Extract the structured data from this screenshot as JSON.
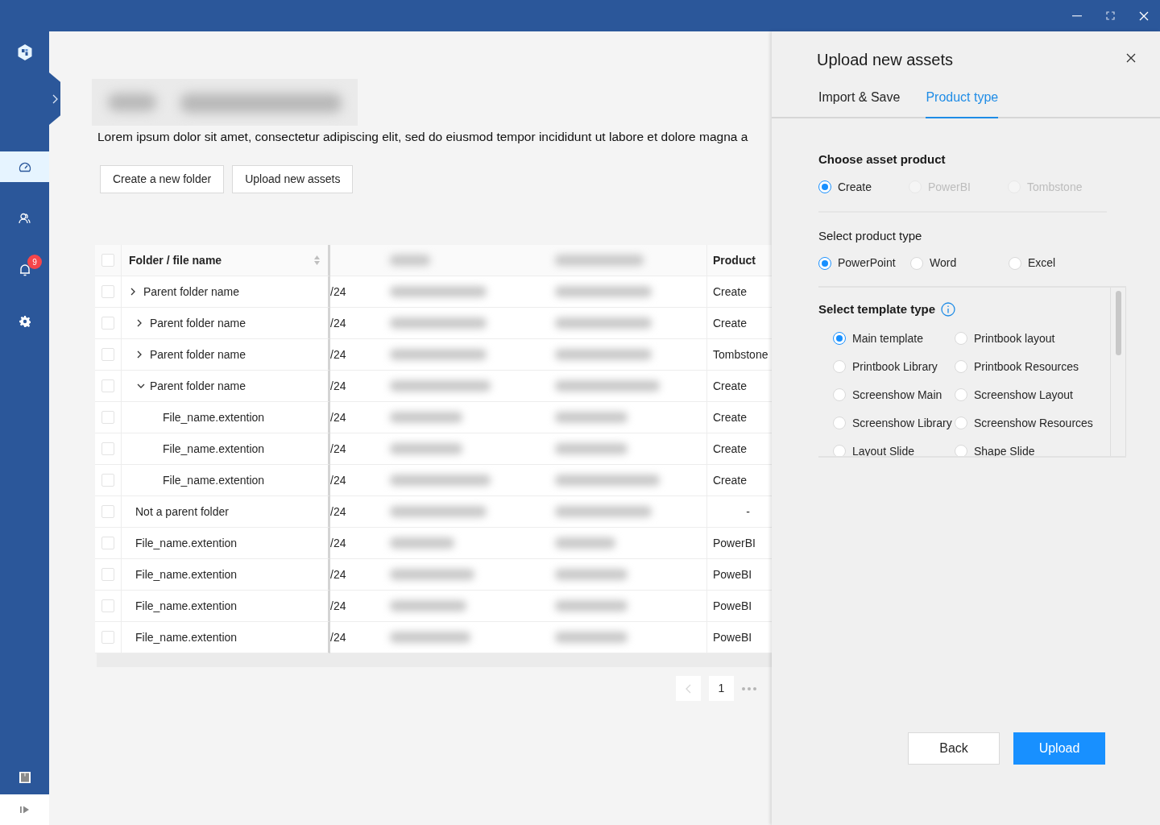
{
  "sidebar": {
    "items": [
      {
        "kind": "dashboard",
        "selected": true
      },
      {
        "kind": "users",
        "selected": false
      },
      {
        "kind": "bell",
        "selected": false,
        "badge": "9"
      },
      {
        "kind": "settings",
        "selected": false
      }
    ]
  },
  "page": {
    "description": "Lorem ipsum dolor sit amet, consectetur adipiscing elit, sed do eiusmod tempor incididunt ut labore et dolore magna a",
    "actions": [
      "Create a new folder",
      "Upload new assets"
    ]
  },
  "table": {
    "header": {
      "name": "Folder / file name",
      "product": "Product",
      "checked": false
    },
    "rows": [
      {
        "kind": "folder",
        "checked": false,
        "name": "Parent folder name",
        "expanded": false,
        "column_2": "/24",
        "product": "Create"
      },
      {
        "kind": "folder",
        "checked": false,
        "name": "Parent folder name",
        "expanded": false,
        "column_2": "/24",
        "product": "Create"
      },
      {
        "kind": "folder",
        "checked": false,
        "name": "Parent folder name",
        "expanded": false,
        "column_2": "/24",
        "product": "Tombstone"
      },
      {
        "kind": "folder",
        "checked": false,
        "name": "Parent folder name",
        "expanded": true,
        "column_2": "/24",
        "product": "Create",
        "children": [
          {
            "kind": "file",
            "checked": false,
            "name": "File_name.extention",
            "column_2": "/24",
            "product": "Create"
          },
          {
            "kind": "file",
            "checked": false,
            "name": "File_name.extention",
            "column_2": "/24",
            "product": "Create"
          },
          {
            "kind": "file",
            "checked": false,
            "name": "File_name.extention",
            "column_2": "/24",
            "product": "Create"
          }
        ]
      },
      {
        "kind": "file",
        "checked": false,
        "name": "Not a parent folder",
        "column_2": "/24",
        "product": "-"
      },
      {
        "kind": "file",
        "checked": false,
        "name": "File_name.extention",
        "column_2": "/24",
        "product": "PowerBI"
      },
      {
        "kind": "file",
        "checked": false,
        "name": "File_name.extention",
        "column_2": "/24",
        "product": "PoweBI"
      },
      {
        "kind": "file",
        "checked": false,
        "name": "File_name.extention",
        "column_2": "/24",
        "product": "PoweBI"
      },
      {
        "kind": "file",
        "checked": false,
        "name": "File_name.extention",
        "column_2": "/24",
        "product": "PoweBI"
      }
    ]
  },
  "pagination": {
    "page": "1"
  },
  "panel": {
    "title": "Upload new assets",
    "tabs": [
      {
        "label": "Import & Save",
        "selected": false
      },
      {
        "label": "Product type",
        "selected": true
      }
    ],
    "sections": [
      {
        "kind": "inline",
        "title": "Choose asset product",
        "bold": true,
        "info": false,
        "options": [
          {
            "label": "Create",
            "selected": true,
            "disabled": false
          },
          {
            "label": "PowerBI",
            "selected": false,
            "disabled": true
          },
          {
            "label": "Tombstone",
            "selected": false,
            "disabled": true
          }
        ]
      },
      {
        "kind": "inline",
        "title": "Select product type",
        "bold": false,
        "info": false,
        "options": [
          {
            "label": "PowerPoint",
            "selected": true,
            "disabled": false
          },
          {
            "label": "Word",
            "selected": false,
            "disabled": false
          },
          {
            "label": "Excel",
            "selected": false,
            "disabled": false
          }
        ]
      },
      {
        "kind": "grid",
        "title": "Select template type",
        "bold": true,
        "info": true,
        "options": [
          {
            "label": "Main template",
            "selected": true,
            "disabled": false
          },
          {
            "label": "Printbook layout",
            "selected": false,
            "disabled": false
          },
          {
            "label": "Printbook Library",
            "selected": false,
            "disabled": false
          },
          {
            "label": "Printbook Resources",
            "selected": false,
            "disabled": false
          },
          {
            "label": "Screenshow Main",
            "selected": false,
            "disabled": false
          },
          {
            "label": "Screenshow Layout",
            "selected": false,
            "disabled": false
          },
          {
            "label": "Screenshow Library",
            "selected": false,
            "disabled": false
          },
          {
            "label": "Screenshow Resources",
            "selected": false,
            "disabled": false
          },
          {
            "label": "Layout Slide",
            "selected": false,
            "disabled": false
          },
          {
            "label": "Shape Slide",
            "selected": false,
            "disabled": false
          }
        ]
      }
    ],
    "buttons": [
      {
        "kind": "secondary",
        "label": "Back"
      },
      {
        "kind": "primary",
        "label": "Upload"
      }
    ]
  }
}
